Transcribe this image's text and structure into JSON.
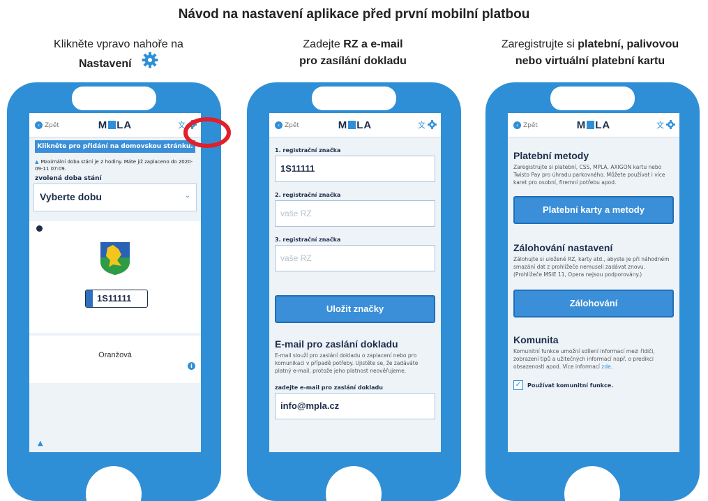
{
  "title": "Návod na nastavení aplikace před první mobilní platbou",
  "steps": [
    {
      "pre": "Klikněte vpravo nahoře na",
      "bold": "Nastavení"
    },
    {
      "pre": "Zadejte ",
      "bold1": "RZ a e-mail",
      "bold2": "pro zasílání dokladu"
    },
    {
      "pre": "Zaregistrujte si ",
      "bold1": "platební, palivovou",
      "bold2": "nebo virtuální platební kartu"
    }
  ],
  "nav": {
    "back": "Zpět",
    "logo_left": "M",
    "logo_right": "LA"
  },
  "phone1": {
    "banner": "Klikněte pro přidání na domovskou stránku.",
    "notice": "Maximální doba stání je 2 hodiny. Máte již zaplaceno do 2020-09-11 07:09.",
    "label": "zvolená doba stání",
    "select": "Vyberte dobu",
    "plate": "1S11111",
    "zone": "Oranžová"
  },
  "phone2": {
    "fields": [
      {
        "label": "1. registrační značka",
        "value": "1S11111",
        "placeholder": ""
      },
      {
        "label": "2. registrační značka",
        "value": "",
        "placeholder": "vaše RZ"
      },
      {
        "label": "3. registrační značka",
        "value": "",
        "placeholder": "vaše RZ"
      }
    ],
    "save_button": "Uložit značky",
    "email_heading": "E-mail pro zaslání dokladu",
    "email_text": "E-mail slouží pro zaslání dokladu o zaplacení nebo pro komunikaci v případě potřeby. Ujistěte se, že zadáváte platný e-mail, protože jeho platnost neověřujeme.",
    "email_label": "zadejte e-mail pro zaslání dokladu",
    "email_value": "info@mpla.cz"
  },
  "phone3": {
    "pay_heading": "Platební metody",
    "pay_text": "Zaregistrujte si platební, CSS, MPLA, AXIGON kartu nebo Twisto Pay pro úhradu parkovného. Můžete používat i více karet pro osobní, firemní potřebu apod.",
    "pay_button": "Platební karty a metody",
    "backup_heading": "Zálohování nastavení",
    "backup_text": "Zálohujte si uložené RZ, karty atd., abyste je při náhodném smazání dat z prohlížeče nemuseli zadávat znovu. (Prohlížeče MSIE 11, Opera nejsou podporovány.)",
    "backup_button": "Zálohování",
    "community_heading": "Komunita",
    "community_text": "Komunitní funkce umožní sdílení informací mezi řidiči, zobrazení tipů a užitečných informací např. o predikci obsazenosti apod. Více informací",
    "community_link": "zde",
    "community_check": "Používat komunitní funkce."
  },
  "colors": {
    "phone": "#2f8fd6",
    "highlight": "#e0202a",
    "navy": "#1d2d4a"
  }
}
